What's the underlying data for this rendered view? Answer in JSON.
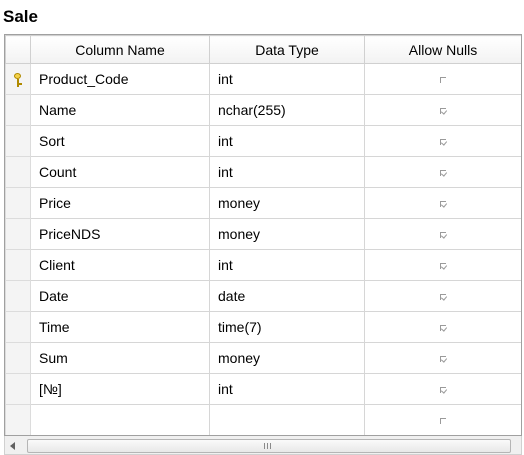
{
  "table_title": "Sale",
  "headers": {
    "column_name": "Column Name",
    "data_type": "Data Type",
    "allow_nulls": "Allow Nulls"
  },
  "rows": [
    {
      "name": "Product_Code",
      "type": "int",
      "allow_nulls": false,
      "primary_key": true
    },
    {
      "name": "Name",
      "type": "nchar(255)",
      "allow_nulls": true,
      "primary_key": false
    },
    {
      "name": "Sort",
      "type": "int",
      "allow_nulls": true,
      "primary_key": false
    },
    {
      "name": "Count",
      "type": "int",
      "allow_nulls": true,
      "primary_key": false
    },
    {
      "name": "Price",
      "type": "money",
      "allow_nulls": true,
      "primary_key": false
    },
    {
      "name": "PriceNDS",
      "type": "money",
      "allow_nulls": true,
      "primary_key": false
    },
    {
      "name": "Client",
      "type": "int",
      "allow_nulls": true,
      "primary_key": false
    },
    {
      "name": "Date",
      "type": "date",
      "allow_nulls": true,
      "primary_key": false
    },
    {
      "name": "Time",
      "type": "time(7)",
      "allow_nulls": true,
      "primary_key": false
    },
    {
      "name": "Sum",
      "type": "money",
      "allow_nulls": true,
      "primary_key": false
    },
    {
      "name": "[№]",
      "type": "int",
      "allow_nulls": true,
      "primary_key": false
    },
    {
      "name": "",
      "type": "",
      "allow_nulls": false,
      "primary_key": false
    }
  ]
}
